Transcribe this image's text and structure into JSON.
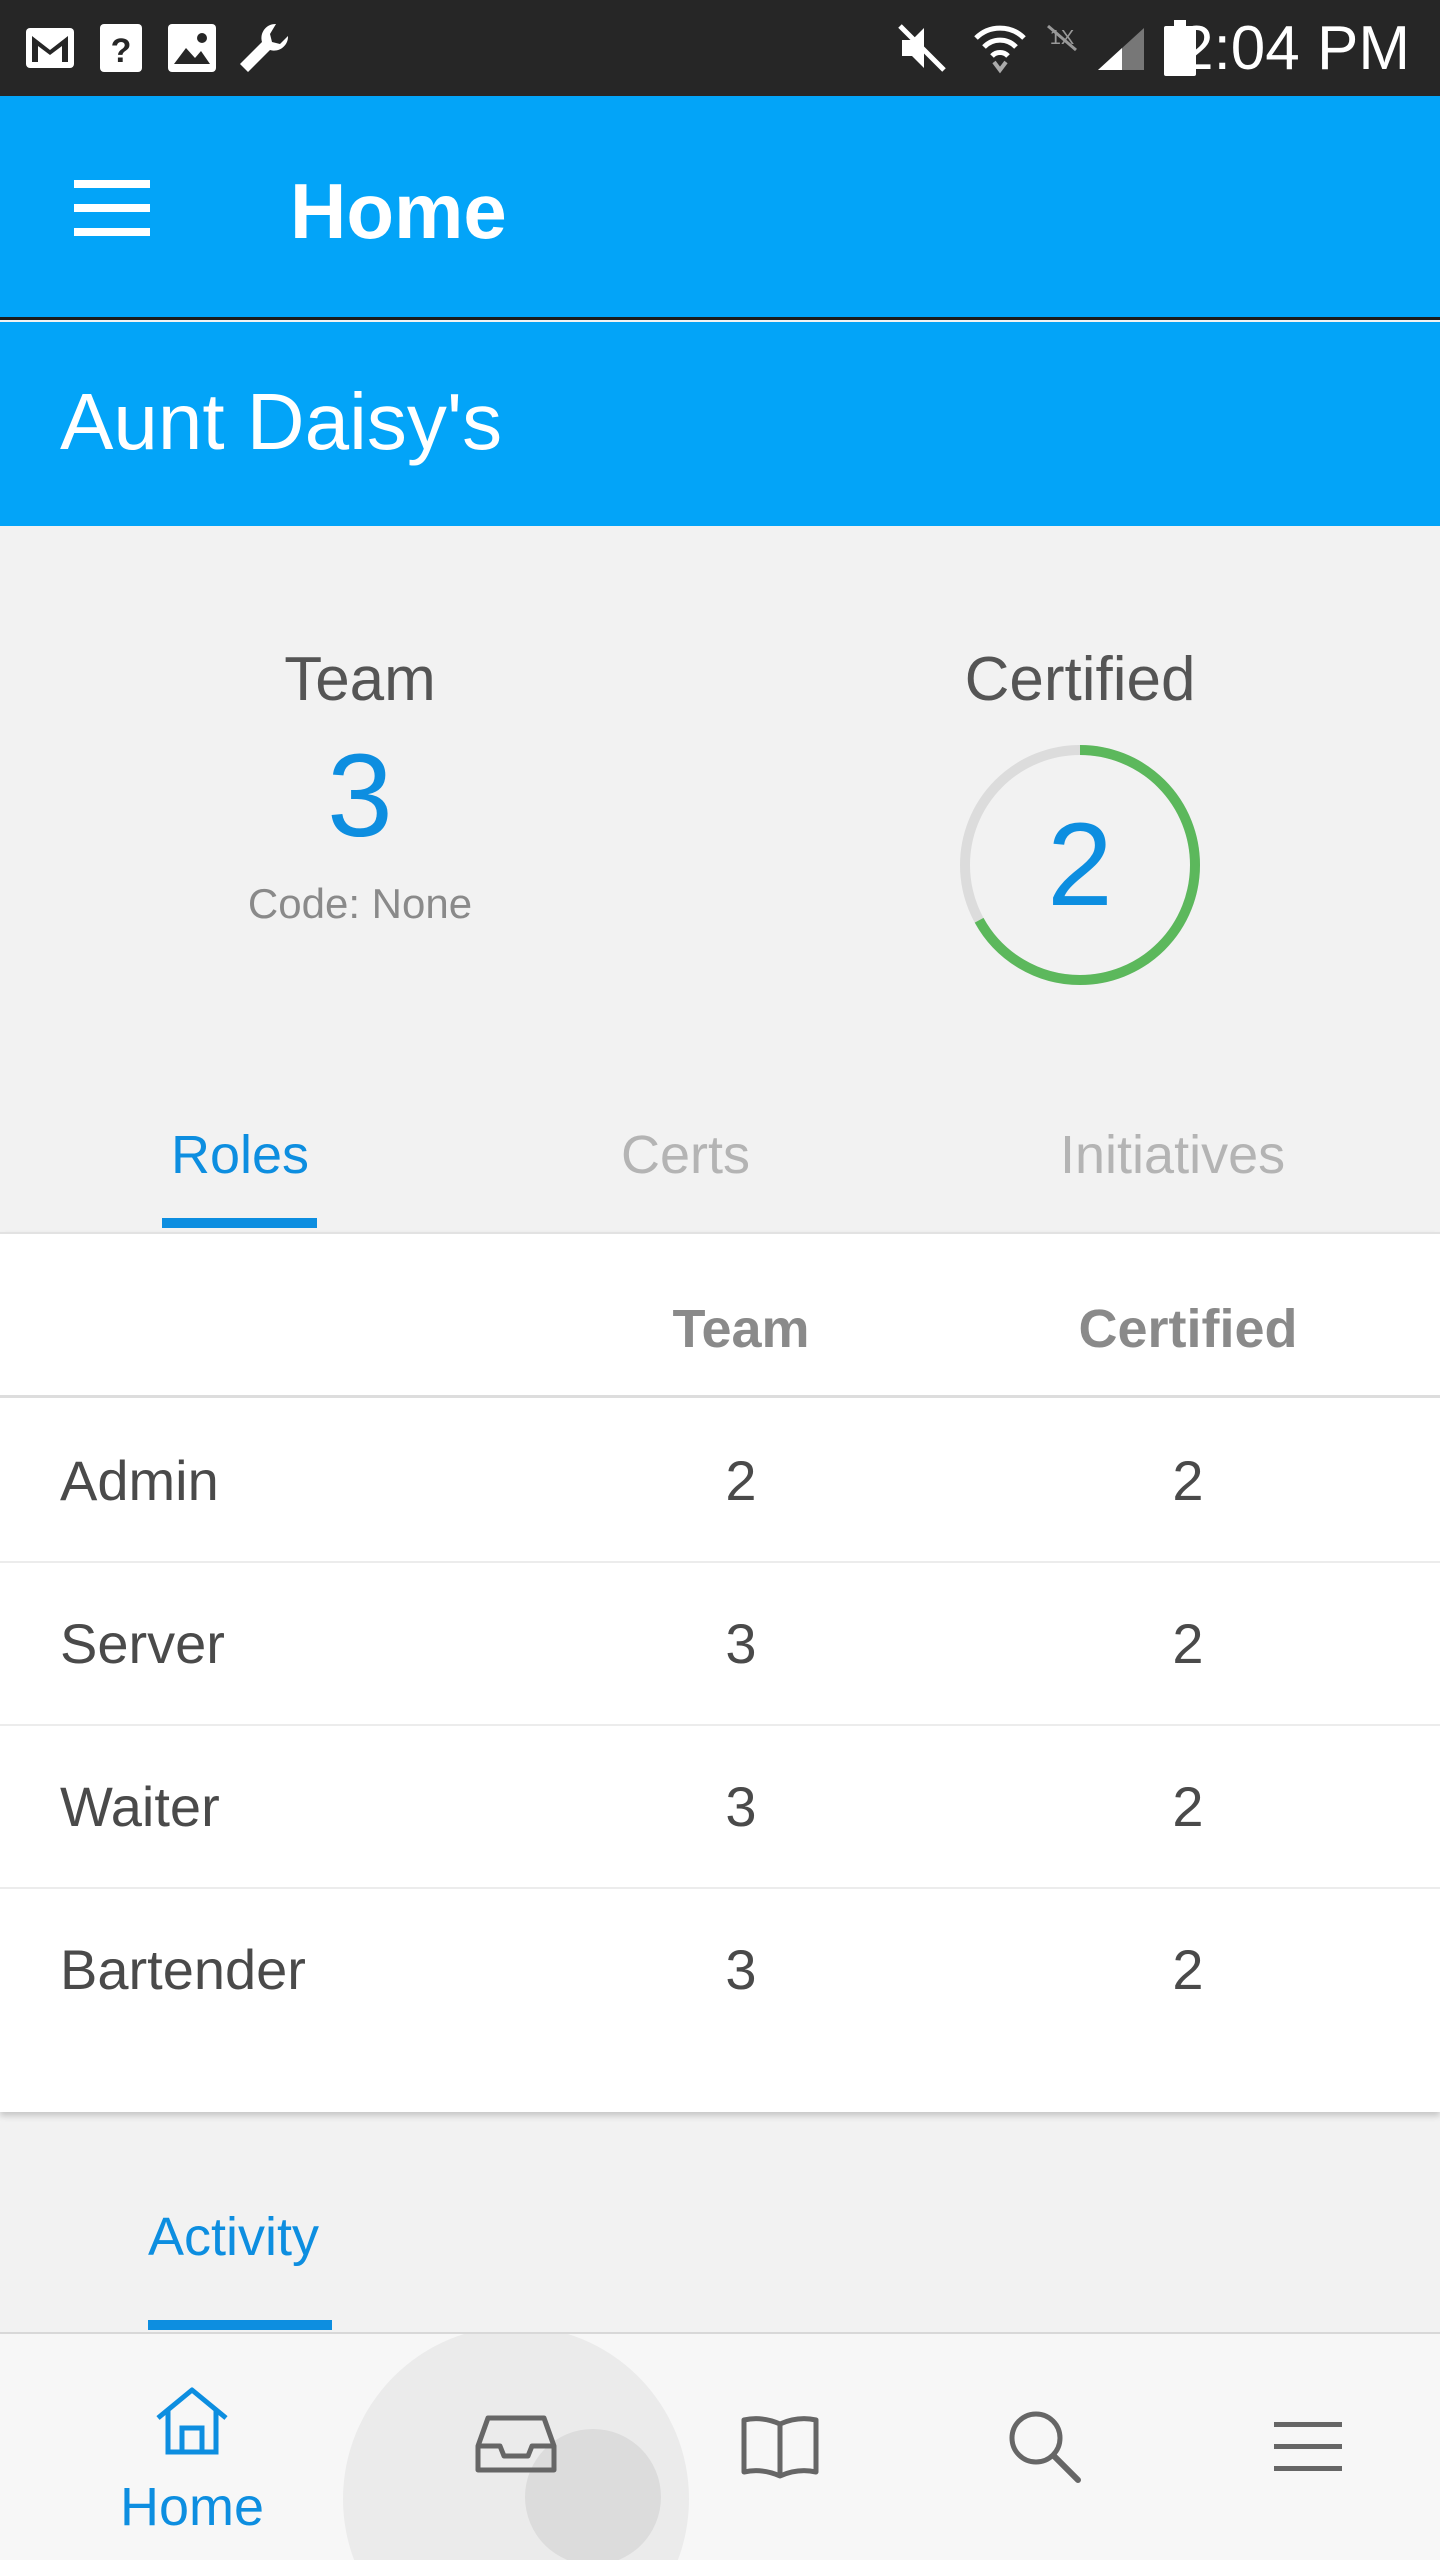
{
  "status_bar": {
    "time": "2:04 PM",
    "icons": [
      "gmail-icon",
      "help-icon",
      "image-icon",
      "wrench-icon",
      "mute-icon",
      "wifi-icon",
      "no-nfc-icon",
      "signal-icon",
      "battery-icon"
    ]
  },
  "app_bar": {
    "title": "Home",
    "menu_icon": "hamburger-menu-icon"
  },
  "store": {
    "name": "Aunt Daisy's"
  },
  "summary": {
    "team_label": "Team",
    "team_count": "3",
    "code_text": "Code: None",
    "certified_label": "Certified",
    "certified_count": "2",
    "certified_progress": 0.67,
    "ring_color": "#5cb85c",
    "ring_track_color": "#dcdcdc"
  },
  "tabs": [
    {
      "label": "Roles",
      "active": true
    },
    {
      "label": "Certs",
      "active": false
    },
    {
      "label": "Initiatives",
      "active": false
    }
  ],
  "roles_table": {
    "headers": [
      "",
      "Team",
      "Certified"
    ],
    "rows": [
      {
        "role": "Admin",
        "team": "2",
        "certified": "2"
      },
      {
        "role": "Server",
        "team": "3",
        "certified": "2"
      },
      {
        "role": "Waiter",
        "team": "3",
        "certified": "2"
      },
      {
        "role": "Bartender",
        "team": "3",
        "certified": "2"
      }
    ]
  },
  "activity": {
    "label": "Activity"
  },
  "bottom_nav": [
    {
      "icon": "home-icon",
      "label": "Home",
      "active": true
    },
    {
      "icon": "inbox-icon",
      "label": "",
      "active": false
    },
    {
      "icon": "book-icon",
      "label": "",
      "active": false
    },
    {
      "icon": "search-icon",
      "label": "",
      "active": false
    },
    {
      "icon": "menu-icon",
      "label": "",
      "active": false
    }
  ],
  "colors": {
    "primary": "#03a4f8",
    "accent_text": "#0d8ee0",
    "status_bar": "#262626",
    "success": "#5cb85c"
  }
}
